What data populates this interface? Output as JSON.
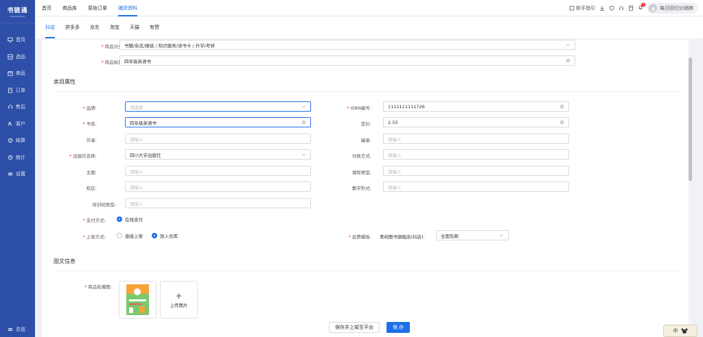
{
  "sidebar": {
    "logo_title": "书链通",
    "logo_sub": "SHULIANTONG",
    "items": [
      {
        "label": "首页",
        "icon": "monitor-icon"
      },
      {
        "label": "选品",
        "icon": "grid-icon"
      },
      {
        "label": "商品",
        "icon": "box-icon"
      },
      {
        "label": "订单",
        "icon": "document-icon"
      },
      {
        "label": "售后",
        "icon": "headset-icon"
      },
      {
        "label": "客户",
        "icon": "users-icon"
      },
      {
        "label": "结算",
        "icon": "settle-icon"
      },
      {
        "label": "统计",
        "icon": "clock-icon"
      },
      {
        "label": "设置",
        "icon": "settings-icon"
      }
    ],
    "bottom_label": "总览"
  },
  "topbar": {
    "tabs": [
      "首页",
      "商品库",
      "原始订单",
      "铺货资料"
    ],
    "active_tab": 3,
    "guide_label": "新手指引",
    "notification_count": "1",
    "user_name": "每日回归分销商"
  },
  "subtabs": {
    "items": [
      "抖店",
      "拼多多",
      "京东",
      "淘宝",
      "天猫",
      "有赞"
    ],
    "active": 0
  },
  "form": {
    "category_label": "商品分类:",
    "category_value": "书籍/杂志/报纸 / 知识服务/读书卡 / 升学/考研",
    "title_label": "商品标题:",
    "title_value": "四年级英语书",
    "section_attrs": "类目属性",
    "brand_label": "品牌:",
    "brand_placeholder": "请选择",
    "isbn_label": "ISBN编号:",
    "isbn_value": "1111111111726",
    "bookname_label": "书名:",
    "bookname_value": "四年级英语书",
    "price_label": "定价:",
    "price_value": "2.55",
    "author_label": "作者:",
    "author_placeholder": "请输入",
    "editor_label": "编者:",
    "editor_placeholder": "请输入",
    "publisher_label": "出版社名称:",
    "publisher_value": "四川大学出版社",
    "payment_label": "付款方式:",
    "payment_placeholder": "请输入",
    "topic_label": "主题:",
    "topic_placeholder": "请输入",
    "course_label": "课程类型:",
    "course_placeholder": "请输入",
    "campus_label": "校区:",
    "campus_placeholder": "请输入",
    "teach_label": "教学形式:",
    "teach_placeholder": "请输入",
    "training_label": "培训班类型:",
    "training_placeholder": "请输入",
    "pay_method_label": "支付方式:",
    "pay_method_option": "在线支付",
    "shelf_label": "上架方式:",
    "shelf_option_direct": "直接上架",
    "shelf_option_store": "放入仓库",
    "freight_label": "运费模板:",
    "freight_shop": "青屿图书旗舰店(抖店):",
    "freight_value": "全国包邮",
    "section_images": "图文信息",
    "carousel_label": "商品轮播图:",
    "upload_label": "上传图片"
  },
  "buttons": {
    "save_and_publish": "保存并上架至平台",
    "save": "保 存"
  },
  "widget": {
    "label": "中"
  }
}
